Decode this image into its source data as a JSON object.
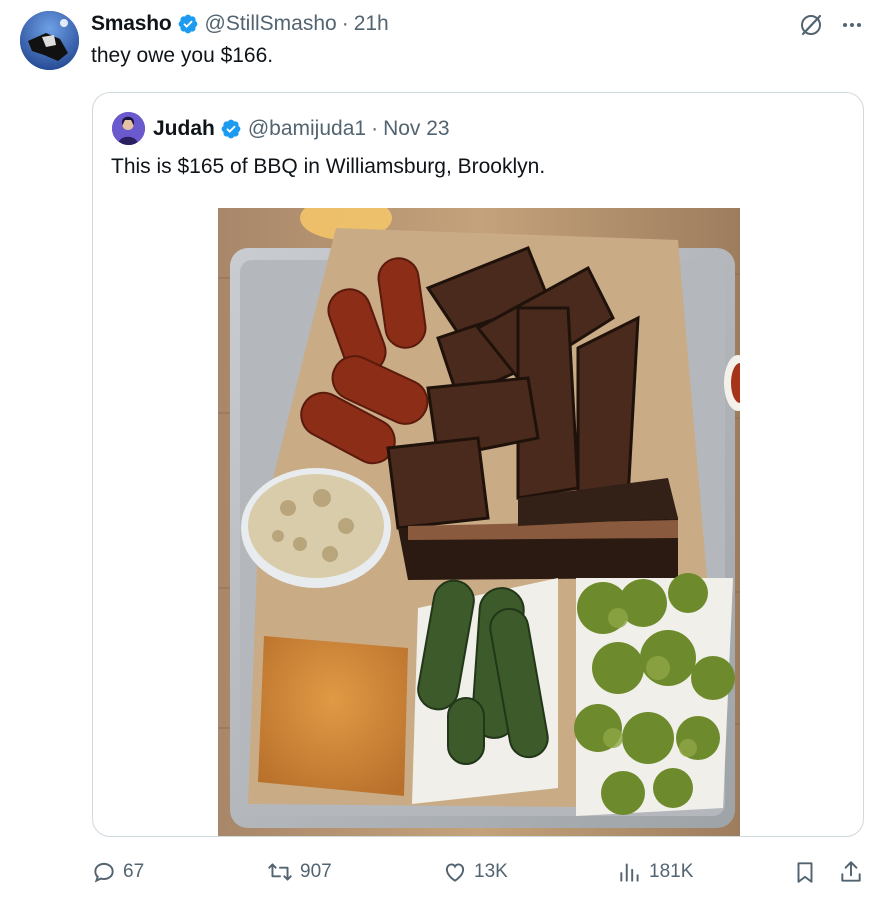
{
  "tweet": {
    "author_name": "Smasho",
    "author_handle": "@StillSmasho",
    "separator": "·",
    "time": "21h",
    "text": "they owe you $166."
  },
  "quoted_tweet": {
    "author_name": "Judah",
    "author_handle": "@bamijuda1",
    "separator": "·",
    "date": "Nov 23",
    "text": "This is $165 of BBQ in Williamsburg, Brooklyn."
  },
  "icons": {
    "top": [
      "grok-icon",
      "more-icon"
    ],
    "actions": [
      "reply-icon",
      "retweet-icon",
      "like-icon",
      "views-icon",
      "bookmark-icon",
      "share-icon"
    ]
  },
  "colors": {
    "verified": "#1d9bf0",
    "muted": "#536471",
    "border": "#cfd9de"
  },
  "actions": {
    "replies": "67",
    "reposts": "907",
    "likes": "13K",
    "views": "181K"
  }
}
